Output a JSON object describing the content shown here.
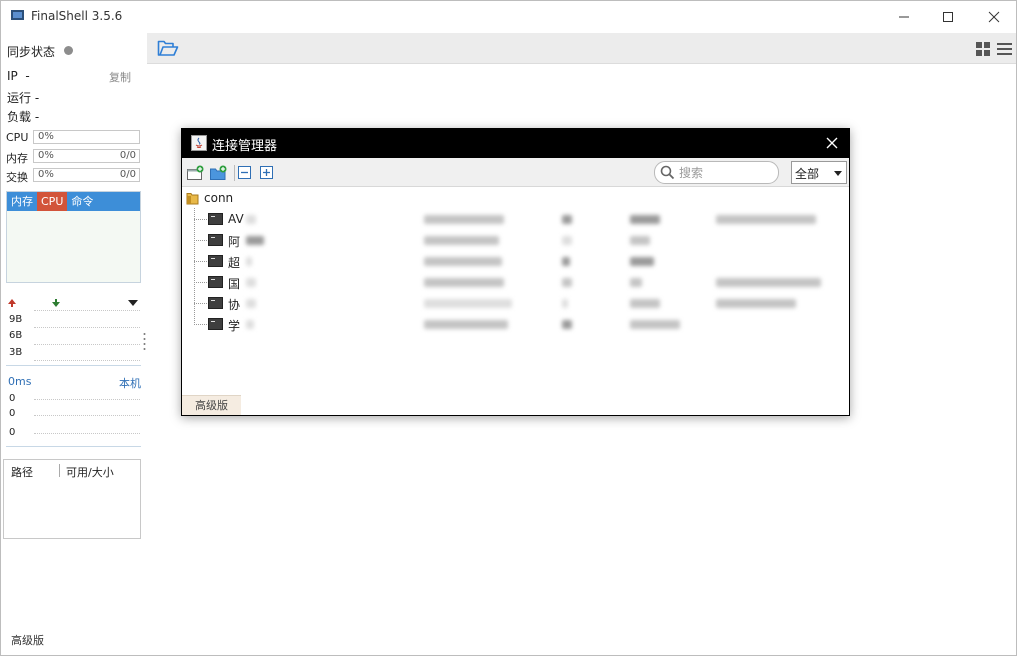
{
  "app": {
    "title": "FinalShell 3.5.6"
  },
  "left_panel": {
    "sync_label": "同步状态",
    "ip_label": "IP",
    "ip_value": "-",
    "copy_label": "复制",
    "run_label": "运行",
    "run_value": "-",
    "load_label": "负载",
    "load_value": "-",
    "cpu": {
      "label": "CPU",
      "percent": "0%"
    },
    "mem": {
      "label": "内存",
      "percent": "0%",
      "count": "0/0"
    },
    "swap": {
      "label": "交换",
      "percent": "0%",
      "count": "0/0"
    },
    "proc_tabs": [
      "内存",
      "CPU",
      "命令"
    ],
    "net_axis": [
      "9B",
      "6B",
      "3B"
    ],
    "ping_label": "0ms",
    "ping_target": "本机",
    "ping_axis": [
      "0",
      "0",
      "0"
    ],
    "disk_headers": [
      "路径",
      "可用/大小"
    ],
    "edition_label": "高级版"
  },
  "dialog": {
    "title": "连接管理器",
    "search_placeholder": "搜索",
    "filter_value": "全部",
    "tree": {
      "root": "conn",
      "items": [
        {
          "name": "AV"
        },
        {
          "name": "阿"
        },
        {
          "name": "超"
        },
        {
          "name": "国"
        },
        {
          "name": "协"
        },
        {
          "name": "学"
        }
      ]
    },
    "edition_tab": "高级版"
  },
  "icons": {
    "app": "finalshell-logo-icon",
    "open_folder": "open-folder-icon",
    "grid_view": "grid-view-icon",
    "list_view": "list-view-icon",
    "new_connection": "new-connection-icon",
    "new_folder": "new-folder-icon",
    "collapse": "collapse-all-icon",
    "expand": "expand-all-icon",
    "search": "search-icon",
    "folder": "folder-icon",
    "terminal": "terminal-icon"
  },
  "colors": {
    "tab_bar": "#3d8ed8",
    "tab_active": "#d2543a",
    "dialog_title_bg": "#000000",
    "link": "#2f6fb5"
  }
}
